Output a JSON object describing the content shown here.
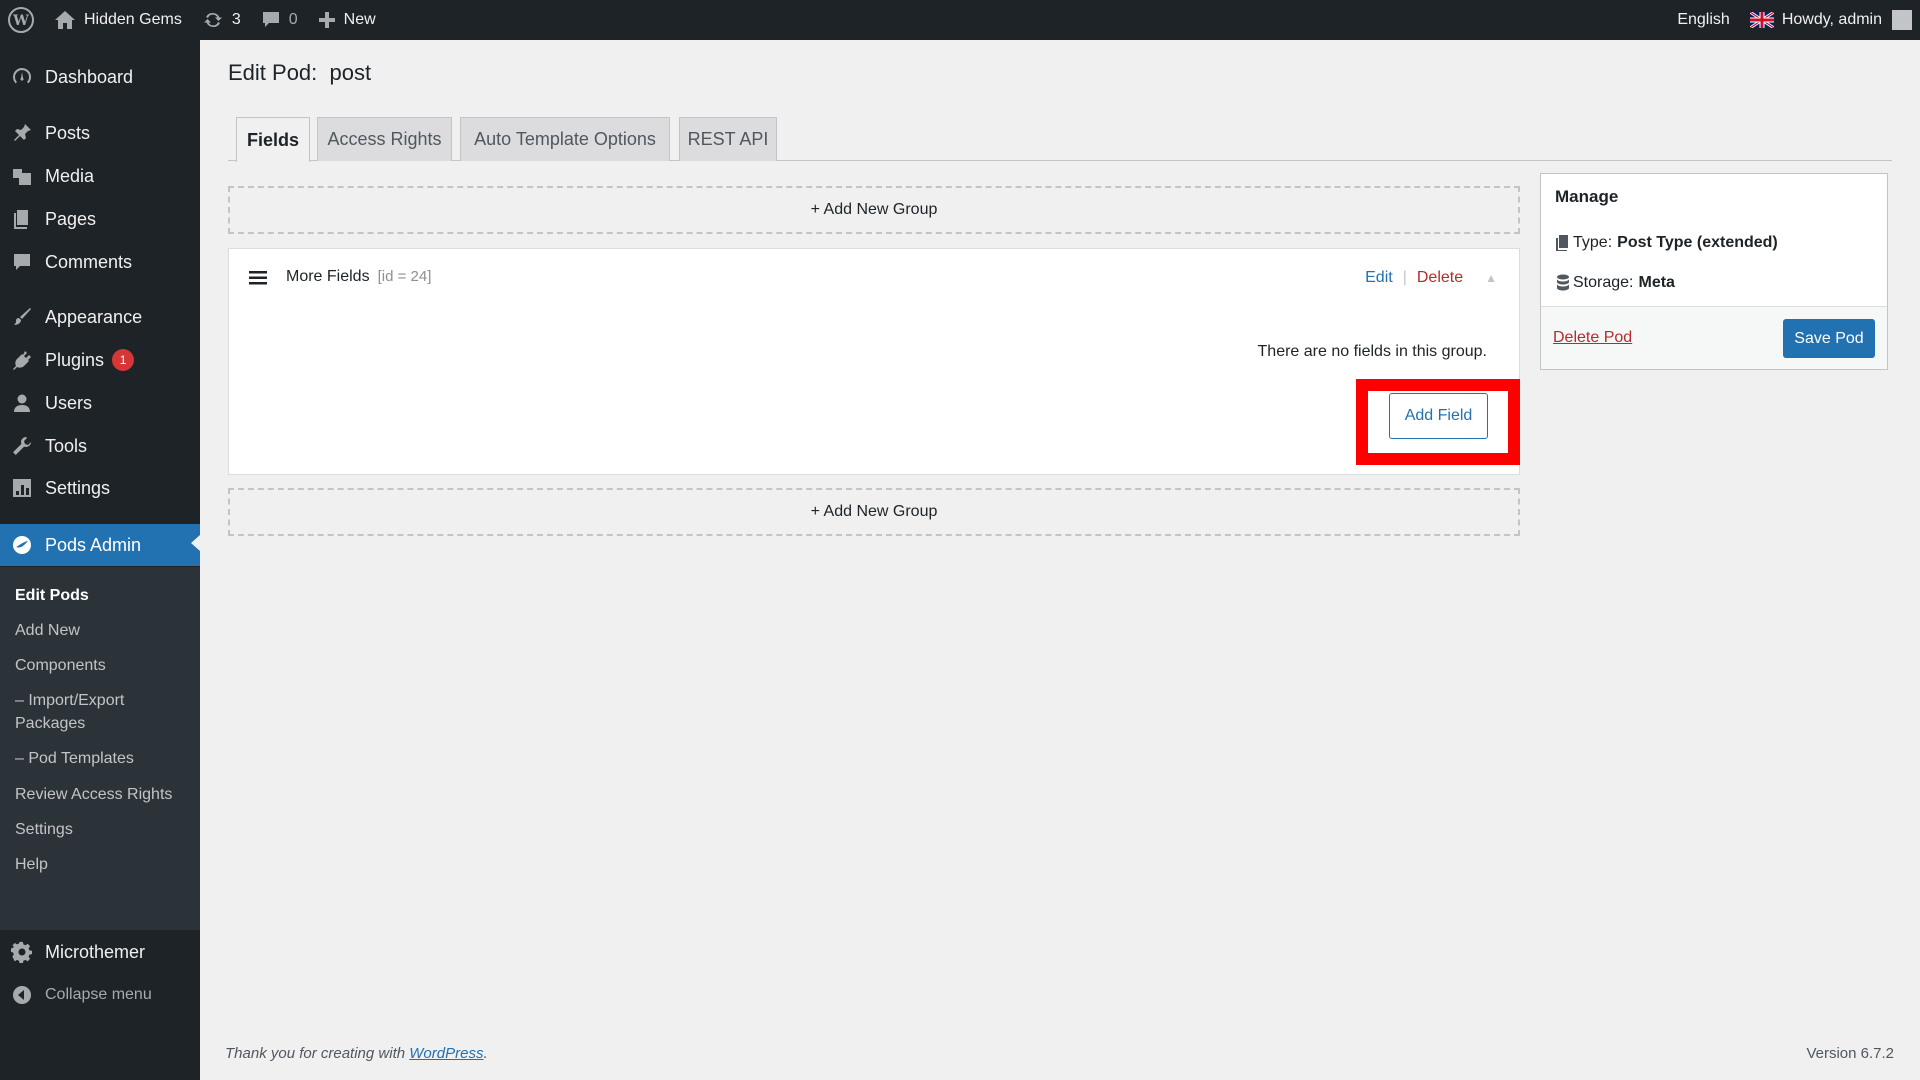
{
  "admin_bar": {
    "site_name": "Hidden Gems",
    "updates_count": "3",
    "comments_count": "0",
    "new_label": "New",
    "language": "English",
    "howdy": "Howdy, admin"
  },
  "sidebar": {
    "items": [
      {
        "label": "Dashboard",
        "icon": "dashboard-icon"
      },
      {
        "label": "Posts",
        "icon": "pushpin-icon"
      },
      {
        "label": "Media",
        "icon": "media-icon"
      },
      {
        "label": "Pages",
        "icon": "pages-icon"
      },
      {
        "label": "Comments",
        "icon": "comment-icon"
      },
      {
        "label": "Appearance",
        "icon": "brush-icon"
      },
      {
        "label": "Plugins",
        "icon": "plug-icon",
        "badge": "1"
      },
      {
        "label": "Users",
        "icon": "user-icon"
      },
      {
        "label": "Tools",
        "icon": "wrench-icon"
      },
      {
        "label": "Settings",
        "icon": "settings-icon"
      },
      {
        "label": "Pods Admin",
        "icon": "pods-icon"
      },
      {
        "label": "Microthemer",
        "icon": "gear-icon"
      }
    ],
    "submenu": [
      "Edit Pods",
      "Add New",
      "Components",
      "– Import/Export Packages",
      "– Pod Templates",
      "Review Access Rights",
      "Settings",
      "Help"
    ],
    "collapse_label": "Collapse menu"
  },
  "page": {
    "title": "Edit Pod:  post"
  },
  "tabs": [
    "Fields",
    "Access Rights",
    "Auto Template Options",
    "REST API"
  ],
  "add_group_label": "+ Add New Group",
  "group": {
    "name": "More Fields",
    "id_label": "[id = 24]",
    "edit_label": "Edit",
    "separator": "|",
    "delete_label": "Delete",
    "empty_message": "There are no fields in this group.",
    "add_field_label": "Add Field"
  },
  "manage": {
    "title": "Manage",
    "type_label": "Type:",
    "type_value": "Post Type (extended)",
    "storage_label": "Storage:",
    "storage_value": "Meta",
    "delete_pod_label": "Delete Pod",
    "save_pod_label": "Save Pod"
  },
  "footer": {
    "thanks_prefix": "Thank you for creating with",
    "wp_link": "WordPress",
    "thanks_suffix": ".",
    "version": "Version 6.7.2"
  },
  "colors": {
    "accent": "#2271b1",
    "sidebar_bg": "#1d2327",
    "danger": "#b32d2e",
    "highlight": "#ff0000"
  }
}
